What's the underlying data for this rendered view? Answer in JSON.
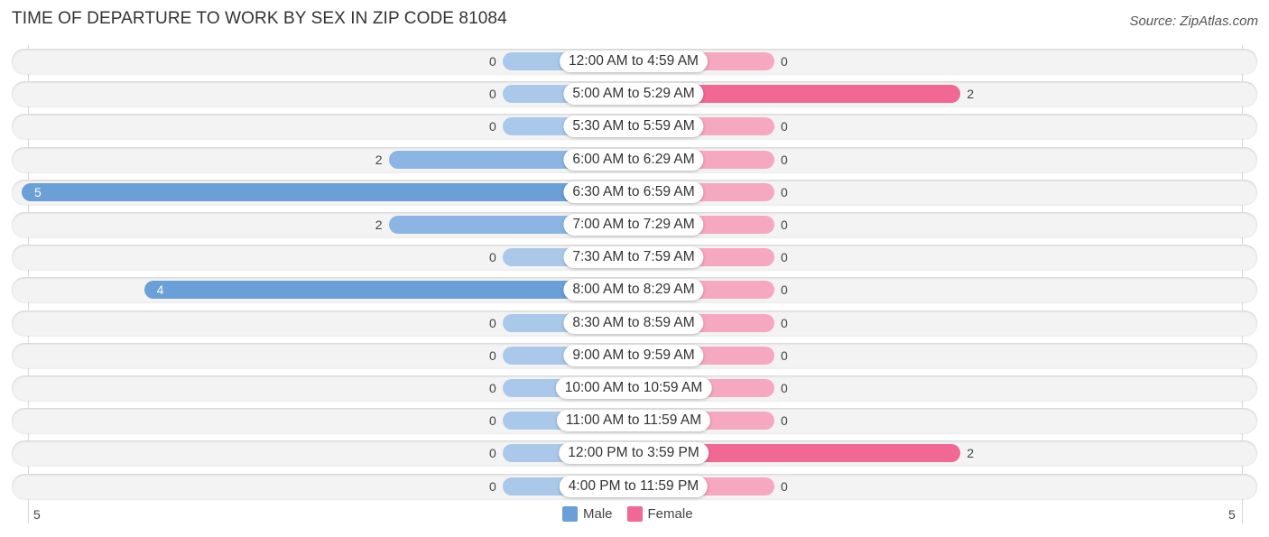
{
  "header": {
    "title": "TIME OF DEPARTURE TO WORK BY SEX IN ZIP CODE 81084",
    "source": "Source: ZipAtlas.com"
  },
  "colors": {
    "male": "#6a9fd8",
    "male_light": "#a9c8ea",
    "female": "#f06893",
    "female_light": "#f5a8c0"
  },
  "chart_data": {
    "type": "bar",
    "orientation": "horizontal-diverging",
    "title": "TIME OF DEPARTURE TO WORK BY SEX IN ZIP CODE 81084",
    "categories": [
      "12:00 AM to 4:59 AM",
      "5:00 AM to 5:29 AM",
      "5:30 AM to 5:59 AM",
      "6:00 AM to 6:29 AM",
      "6:30 AM to 6:59 AM",
      "7:00 AM to 7:29 AM",
      "7:30 AM to 7:59 AM",
      "8:00 AM to 8:29 AM",
      "8:30 AM to 8:59 AM",
      "9:00 AM to 9:59 AM",
      "10:00 AM to 10:59 AM",
      "11:00 AM to 11:59 AM",
      "12:00 PM to 3:59 PM",
      "4:00 PM to 11:59 PM"
    ],
    "series": [
      {
        "name": "Male",
        "values": [
          0,
          0,
          0,
          2,
          5,
          2,
          0,
          4,
          0,
          0,
          0,
          0,
          0,
          0
        ]
      },
      {
        "name": "Female",
        "values": [
          0,
          2,
          0,
          0,
          0,
          0,
          0,
          0,
          0,
          0,
          0,
          0,
          2,
          0
        ]
      }
    ],
    "axis": {
      "left_label": "5",
      "right_label": "5",
      "range": [
        -5,
        5
      ]
    },
    "legend": {
      "position": "bottom-center",
      "entries": [
        "Male",
        "Female"
      ]
    },
    "grid": true
  }
}
